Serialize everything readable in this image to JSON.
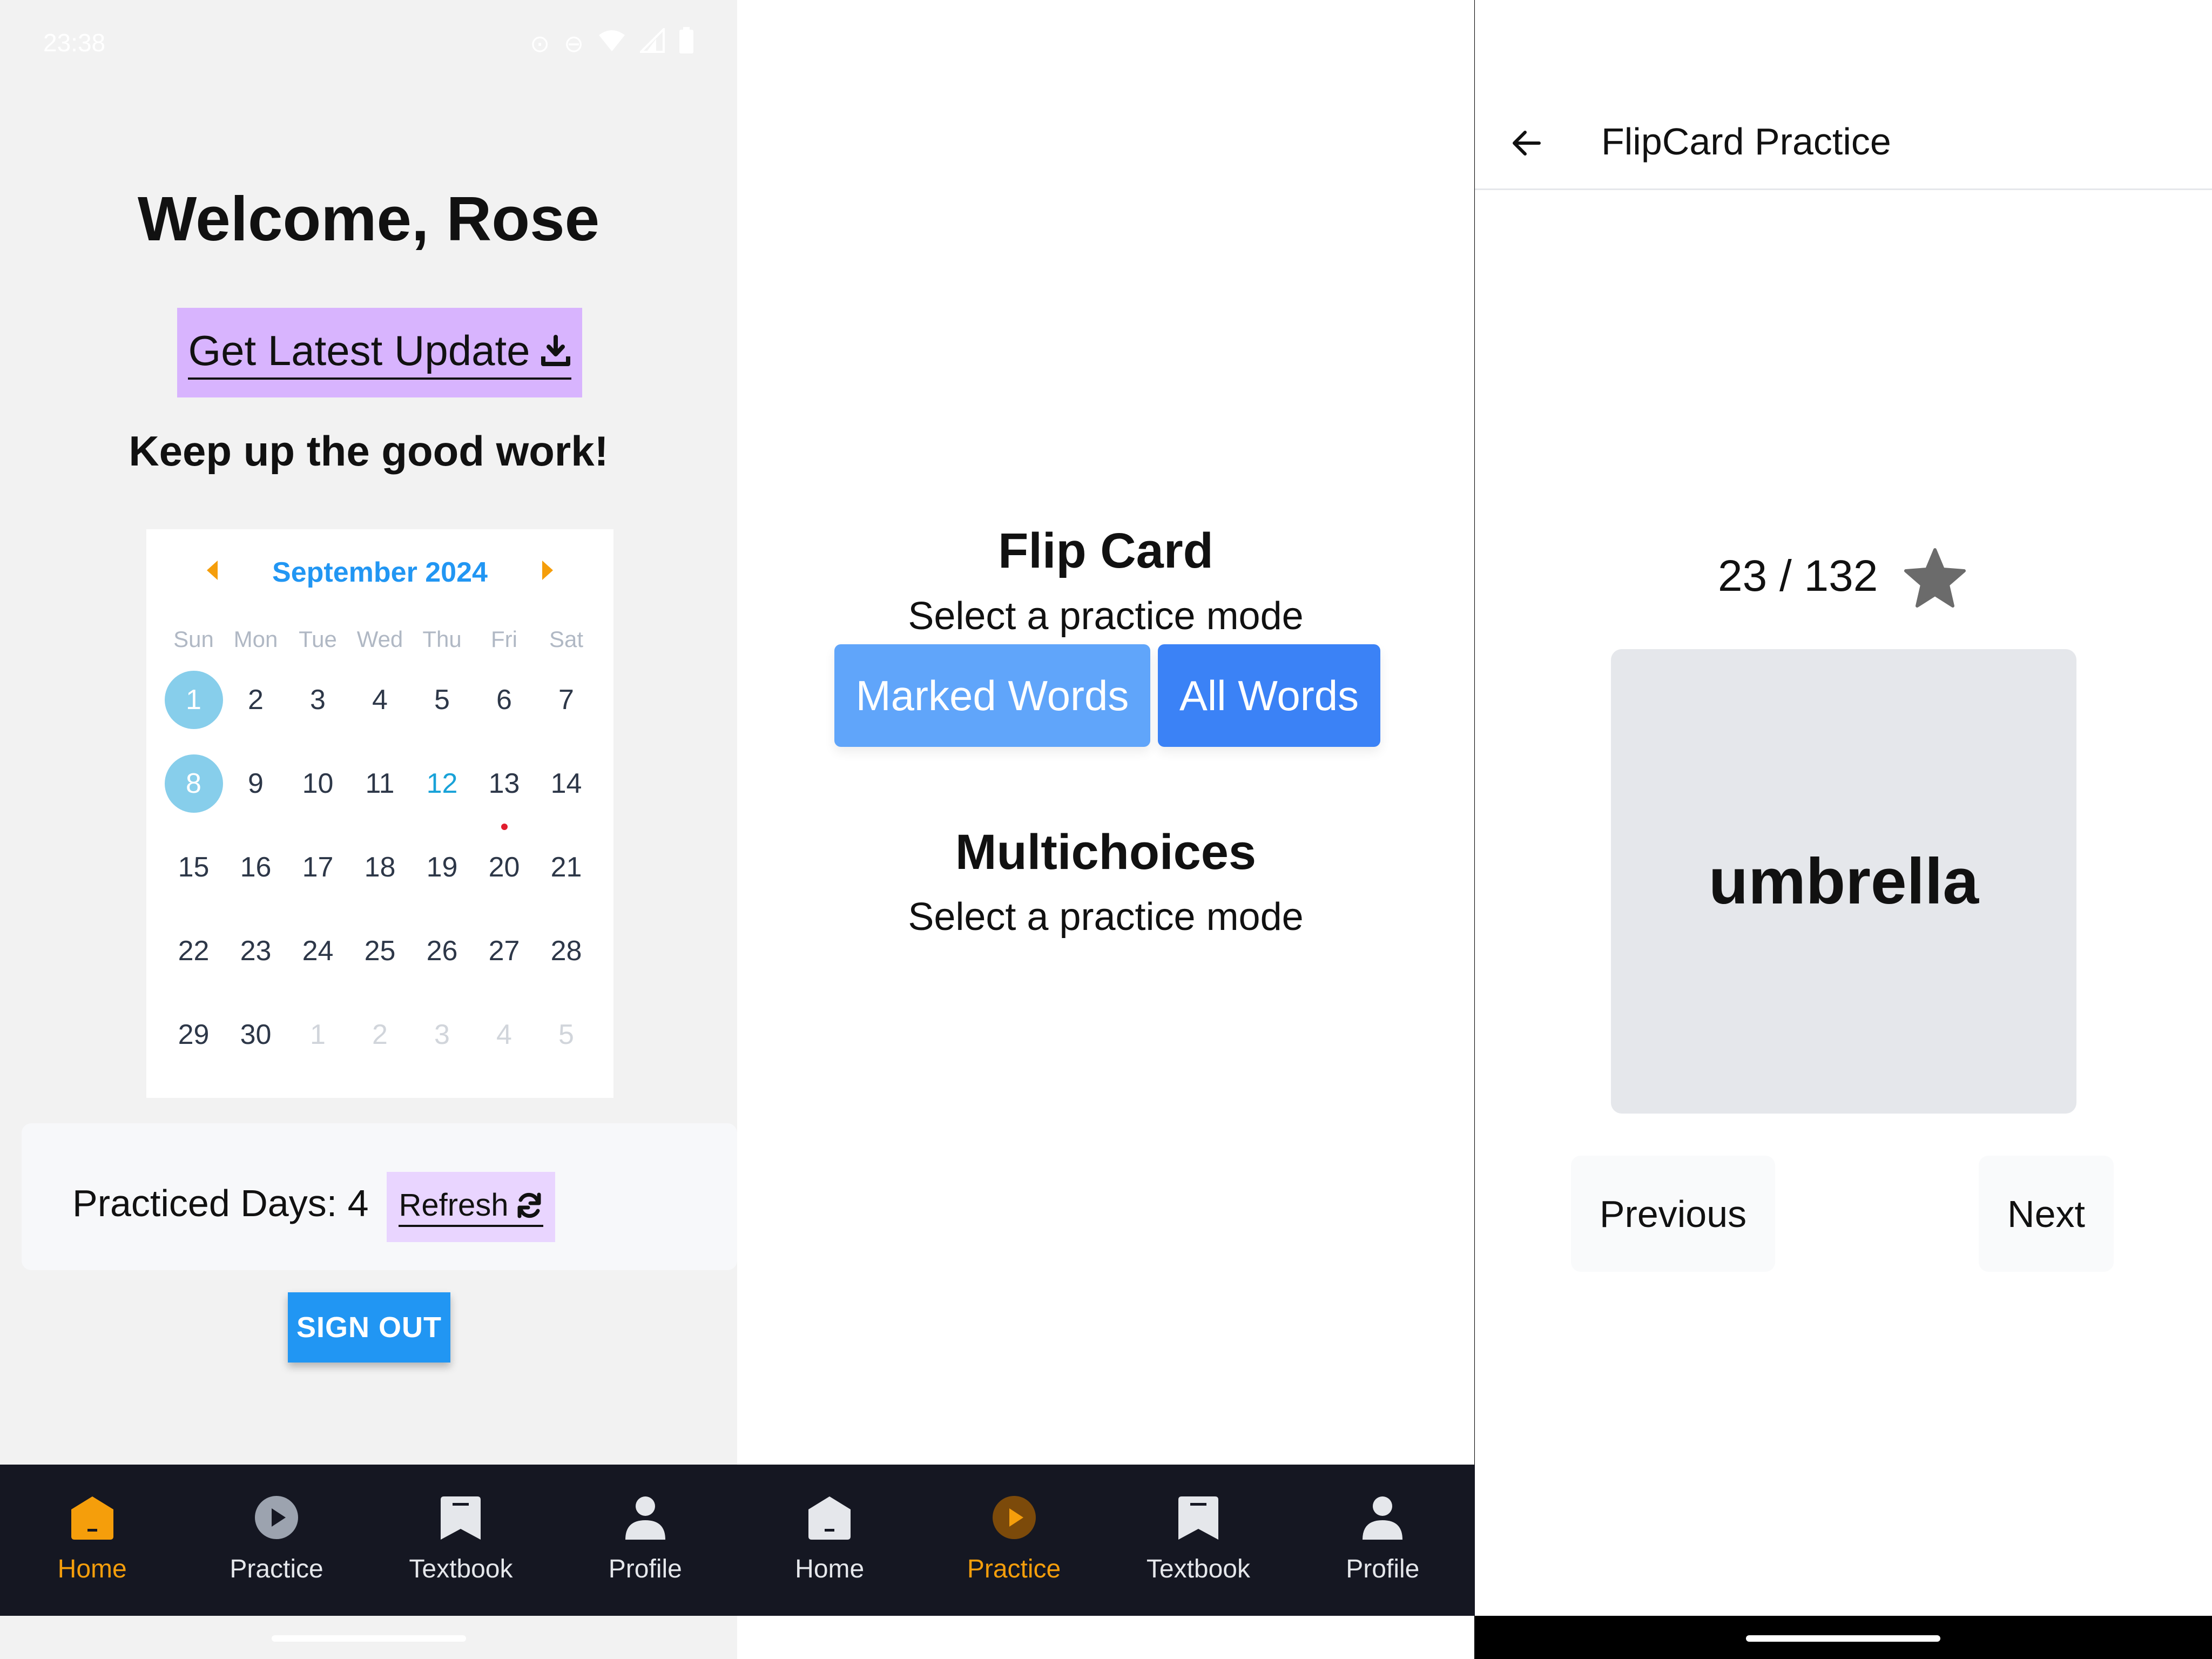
{
  "status_bar": {
    "time": "23:38",
    "icons": [
      "alarm-icon",
      "dnd-icon",
      "wifi-icon",
      "signal-icon",
      "battery-icon"
    ]
  },
  "home": {
    "welcome": "Welcome, Rose",
    "update_button": "Get Latest Update",
    "encouragement": "Keep up the good work!",
    "calendar": {
      "month": "September 2024",
      "weekdays": [
        "Sun",
        "Mon",
        "Tue",
        "Wed",
        "Thu",
        "Fri",
        "Sat"
      ],
      "days": [
        {
          "n": "1",
          "state": "sel"
        },
        {
          "n": "2"
        },
        {
          "n": "3"
        },
        {
          "n": "4"
        },
        {
          "n": "5"
        },
        {
          "n": "6"
        },
        {
          "n": "7"
        },
        {
          "n": "8",
          "state": "sel"
        },
        {
          "n": "9"
        },
        {
          "n": "10"
        },
        {
          "n": "11"
        },
        {
          "n": "12",
          "state": "today"
        },
        {
          "n": "13",
          "dot": true
        },
        {
          "n": "14"
        },
        {
          "n": "15"
        },
        {
          "n": "16"
        },
        {
          "n": "17"
        },
        {
          "n": "18"
        },
        {
          "n": "19"
        },
        {
          "n": "20"
        },
        {
          "n": "21"
        },
        {
          "n": "22"
        },
        {
          "n": "23"
        },
        {
          "n": "24"
        },
        {
          "n": "25"
        },
        {
          "n": "26"
        },
        {
          "n": "27"
        },
        {
          "n": "28"
        },
        {
          "n": "29"
        },
        {
          "n": "30"
        },
        {
          "n": "1",
          "state": "muted"
        },
        {
          "n": "2",
          "state": "muted"
        },
        {
          "n": "3",
          "state": "muted"
        },
        {
          "n": "4",
          "state": "muted"
        },
        {
          "n": "5",
          "state": "muted"
        }
      ]
    },
    "practiced_label": "Practiced Days: 4",
    "refresh_button": "Refresh",
    "sign_out_button": "SIGN OUT"
  },
  "practice": {
    "flip_card_title": "Flip Card",
    "flip_card_subtitle": "Select a practice mode",
    "marked_words_button": "Marked Words",
    "all_words_button": "All Words",
    "multichoices_title": "Multichoices",
    "multichoices_subtitle": "Select a practice mode"
  },
  "nav": {
    "home": "Home",
    "practice": "Practice",
    "textbook": "Textbook",
    "profile": "Profile"
  },
  "flipcard": {
    "title": "FlipCard Practice",
    "counter": "23 / 132",
    "word": "umbrella",
    "previous_button": "Previous",
    "next_button": "Next"
  },
  "colors": {
    "accent_orange": "#f59e0b",
    "calendar_blue": "#2196f3",
    "selected_day": "#87ceeb",
    "update_purple": "#d8b4fe",
    "nav_background": "#151722"
  }
}
